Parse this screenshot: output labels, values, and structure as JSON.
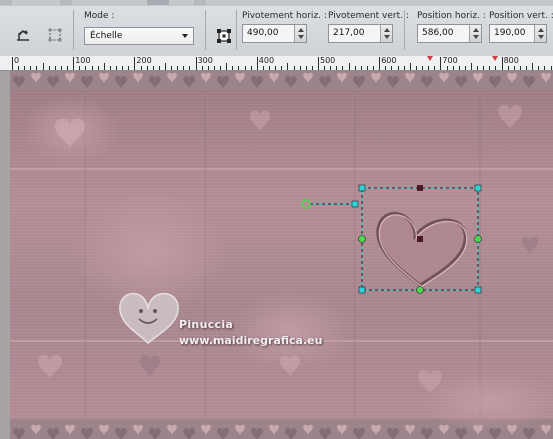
{
  "toolbar": {
    "mode": {
      "label": "Mode :",
      "value": "Échelle"
    },
    "fields": [
      {
        "label": "Pivotement horiz. :",
        "value": "490,00"
      },
      {
        "label": "Pivotement vert. :",
        "value": "217,00"
      },
      {
        "label": "Position horiz. :",
        "value": "586,00"
      },
      {
        "label": "Position vert. :",
        "value": "190,00"
      }
    ]
  },
  "ruler": {
    "labels": [
      "0",
      "100",
      "200",
      "300",
      "400",
      "500",
      "600",
      "700",
      "800"
    ]
  },
  "canvas": {
    "signature": {
      "name": "Pinuccia",
      "url": "www.maidiregrafica.eu"
    }
  },
  "colors": {
    "background_pink": "#b38a93",
    "selection_cyan": "#2fd3d8",
    "handle_green": "#4fd84f",
    "accent_dark": "#4a1a22"
  }
}
